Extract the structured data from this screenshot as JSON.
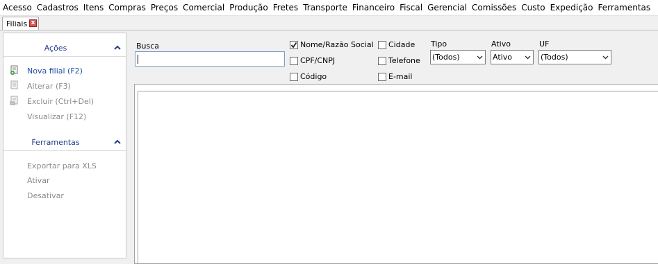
{
  "menu": [
    "Acesso",
    "Cadastros",
    "Itens",
    "Compras",
    "Preços",
    "Comercial",
    "Produção",
    "Fretes",
    "Transporte",
    "Financeiro",
    "Fiscal",
    "Gerencial",
    "Comissões",
    "Custo",
    "Expedição",
    "Ferramentas"
  ],
  "tab": {
    "label": "Filiais",
    "close": "x"
  },
  "sidebar": {
    "acoes": {
      "title": "Ações",
      "items": [
        {
          "label": "Nova filial (F2)",
          "icon": "new-document-icon"
        },
        {
          "label": "Alterar (F3)",
          "icon": "edit-document-icon"
        },
        {
          "label": "Excluir (Ctrl+Del)",
          "icon": "delete-document-icon"
        },
        {
          "label": "Visualizar (F12)"
        }
      ]
    },
    "ferramentas": {
      "title": "Ferramentas",
      "items": [
        {
          "label": "Exportar para XLS"
        },
        {
          "label": "Ativar"
        },
        {
          "label": "Desativar"
        }
      ]
    }
  },
  "search": {
    "label": "Busca",
    "value": ""
  },
  "checks": [
    {
      "label": "Nome/Razão Social",
      "checked": true
    },
    {
      "label": "CPF/CNPJ",
      "checked": false
    },
    {
      "label": "Código",
      "checked": false
    },
    {
      "label": "Cidade",
      "checked": false
    },
    {
      "label": "Telefone",
      "checked": false
    },
    {
      "label": "E-mail",
      "checked": false
    }
  ],
  "filters": {
    "tipo": {
      "label": "Tipo",
      "value": "(Todos)"
    },
    "ativo": {
      "label": "Ativo",
      "value": "Ativo"
    },
    "uf": {
      "label": "UF",
      "value": "(Todos)"
    }
  },
  "colors": {
    "accent": "#1f3c88",
    "link_active": "#1f4ea3",
    "disabled": "#8a8a8a",
    "close": "#d9534f"
  }
}
